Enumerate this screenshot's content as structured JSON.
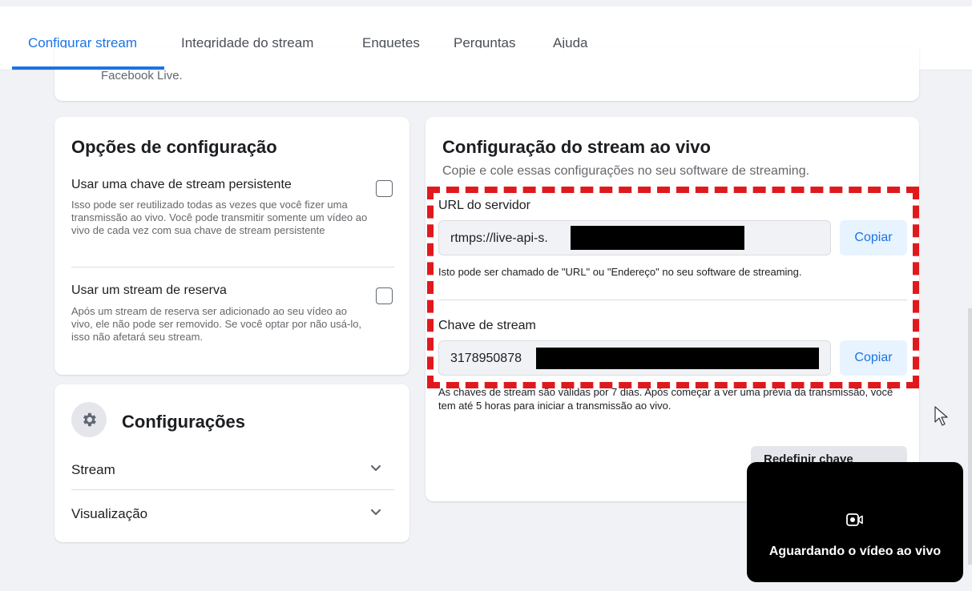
{
  "tabs": [
    {
      "label": "Configurar stream",
      "active": true
    },
    {
      "label": "Integridade do stream",
      "active": false
    },
    {
      "label": "Enquetes",
      "active": false
    },
    {
      "label": "Perguntas",
      "active": false
    },
    {
      "label": "Ajuda",
      "active": false
    }
  ],
  "top_card": {
    "text": "Facebook Live."
  },
  "options_card": {
    "title": "Opções de configuração",
    "persistent_key": {
      "title": "Usar uma chave de stream persistente",
      "description": "Isso pode ser reutilizado todas as vezes que você fizer uma transmissão ao vivo. Você pode transmitir somente um vídeo ao vivo de cada vez com sua chave de stream persistente",
      "checked": false
    },
    "backup_stream": {
      "title": "Usar um stream de reserva",
      "description": "Após um stream de reserva ser adicionado ao seu vídeo ao vivo, ele não pode ser removido. Se você optar por não usá-lo, isso não afetará seu stream.",
      "checked": false
    }
  },
  "settings_card": {
    "title": "Configurações",
    "icon": "gear-icon",
    "rows": [
      {
        "label": "Stream"
      },
      {
        "label": "Visualização"
      }
    ]
  },
  "live_card": {
    "title": "Configuração do stream ao vivo",
    "subtitle": "Copie e cole essas configurações no seu software de streaming.",
    "server_url": {
      "label": "URL do servidor",
      "value": "rtmps://live-api-s.",
      "copy_label": "Copiar",
      "hint": "Isto pode ser chamado de \"URL\" ou \"Endereço\" no seu software de streaming."
    },
    "stream_key": {
      "label": "Chave de stream",
      "value": "3178950878",
      "copy_label": "Copiar",
      "hint": "As chaves de stream são válidas por 7 dias. Após começar a ver uma prévia da transmissão, você tem até 5 horas para iniciar a transmissão ao vivo."
    },
    "secondary_button": "Redefinir chave"
  },
  "preview": {
    "text": "Aguardando o vídeo ao vivo",
    "icon": "video-camera-icon"
  },
  "colors": {
    "accent": "#1b74e4",
    "highlight_dash": "#e0191d",
    "background": "#f0f2f5"
  }
}
